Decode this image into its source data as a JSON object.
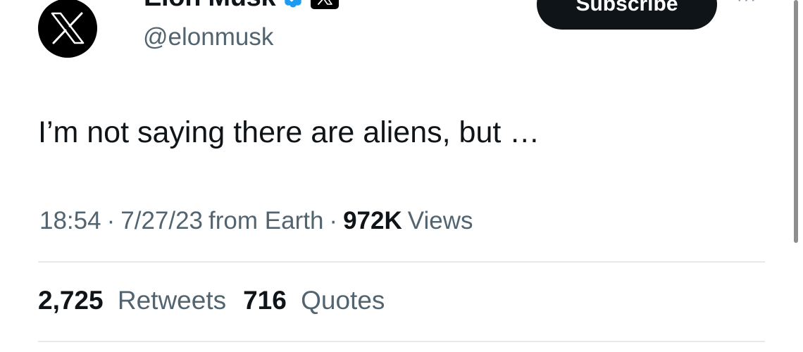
{
  "author": {
    "display_name": "Elon Musk",
    "handle": "@elonmusk",
    "avatar_icon": "x-logo-icon",
    "verified_icon": "verified-badge-icon",
    "affiliation_icon": "x-affiliation-badge-icon"
  },
  "actions": {
    "subscribe_label": "Subscribe",
    "more_label": "···"
  },
  "tweet": {
    "text": "I’m not saying there are aliens, but …",
    "time": "18:54",
    "separator": "·",
    "date": "7/27/23",
    "source": "from Earth",
    "views_count": "972K",
    "views_label": "Views"
  },
  "stats": {
    "retweets_count": "2,725",
    "retweets_label": "Retweets",
    "quotes_count": "716",
    "quotes_label": "Quotes"
  },
  "colors": {
    "primary_text": "#0f1419",
    "secondary_text": "#536471",
    "verified_blue": "#1d9bf0",
    "divider": "#e7e9ea"
  }
}
